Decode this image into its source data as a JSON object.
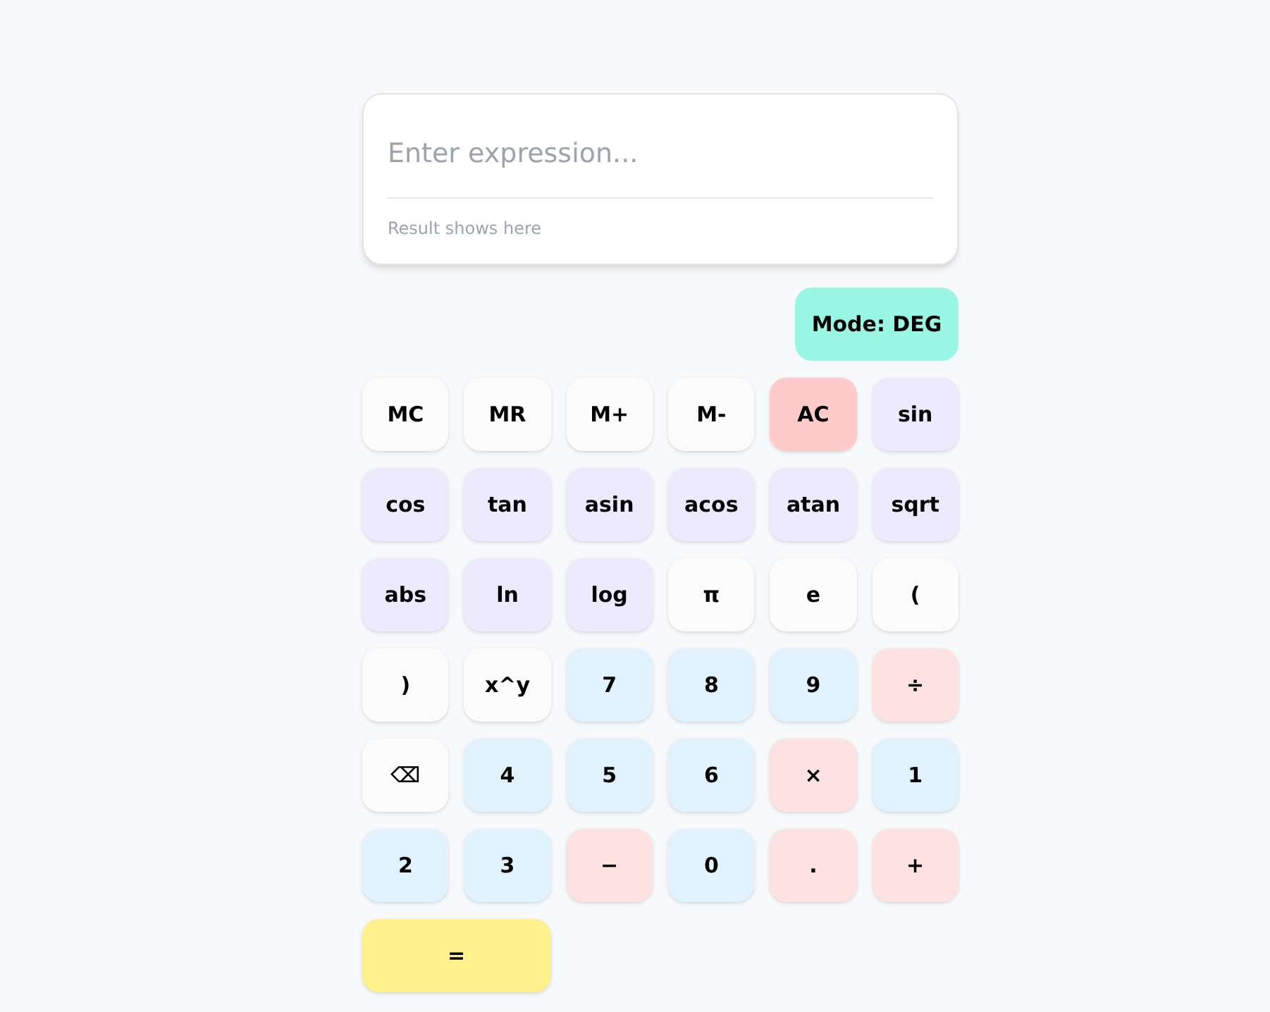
{
  "display": {
    "placeholder": "Enter expression...",
    "result": "Result shows here"
  },
  "mode_button": "Mode: DEG",
  "keys": [
    {
      "label": "MC",
      "kind": "memory"
    },
    {
      "label": "MR",
      "kind": "memory"
    },
    {
      "label": "M+",
      "kind": "memory"
    },
    {
      "label": "M-",
      "kind": "memory"
    },
    {
      "label": "AC",
      "kind": "clear"
    },
    {
      "label": "sin",
      "kind": "function"
    },
    {
      "label": "cos",
      "kind": "function"
    },
    {
      "label": "tan",
      "kind": "function"
    },
    {
      "label": "asin",
      "kind": "function"
    },
    {
      "label": "acos",
      "kind": "function"
    },
    {
      "label": "atan",
      "kind": "function"
    },
    {
      "label": "sqrt",
      "kind": "function"
    },
    {
      "label": "abs",
      "kind": "function"
    },
    {
      "label": "ln",
      "kind": "function"
    },
    {
      "label": "log",
      "kind": "function"
    },
    {
      "label": "π",
      "kind": "plain"
    },
    {
      "label": "e",
      "kind": "plain"
    },
    {
      "label": "(",
      "kind": "plain"
    },
    {
      "label": ")",
      "kind": "plain"
    },
    {
      "label": "x^y",
      "kind": "plain"
    },
    {
      "label": "7",
      "kind": "digit"
    },
    {
      "label": "8",
      "kind": "digit"
    },
    {
      "label": "9",
      "kind": "digit"
    },
    {
      "label": "÷",
      "kind": "operator"
    },
    {
      "label": "⌫",
      "kind": "plain"
    },
    {
      "label": "4",
      "kind": "digit"
    },
    {
      "label": "5",
      "kind": "digit"
    },
    {
      "label": "6",
      "kind": "digit"
    },
    {
      "label": "×",
      "kind": "operator"
    },
    {
      "label": "1",
      "kind": "digit"
    },
    {
      "label": "2",
      "kind": "digit"
    },
    {
      "label": "3",
      "kind": "digit"
    },
    {
      "label": "−",
      "kind": "operator"
    },
    {
      "label": "0",
      "kind": "digit"
    },
    {
      "label": ".",
      "kind": "operator"
    },
    {
      "label": "+",
      "kind": "operator"
    },
    {
      "label": "=",
      "kind": "equals"
    }
  ]
}
